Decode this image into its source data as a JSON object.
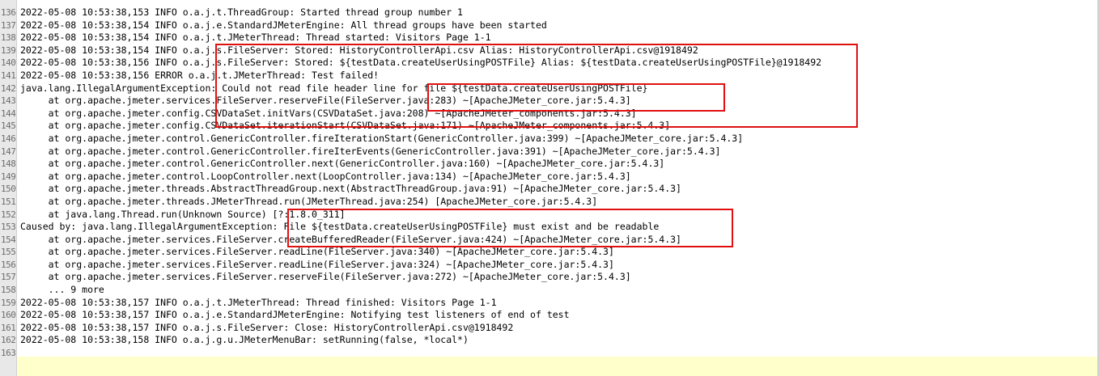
{
  "editor": {
    "lines": [
      {
        "num": "136",
        "text": "2022-05-08 10:53:38,153 INFO o.a.j.t.ThreadGroup: Started thread group number 1"
      },
      {
        "num": "137",
        "text": "2022-05-08 10:53:38,154 INFO o.a.j.e.StandardJMeterEngine: All thread groups have been started"
      },
      {
        "num": "138",
        "text": "2022-05-08 10:53:38,154 INFO o.a.j.t.JMeterThread: Thread started: Visitors Page 1-1"
      },
      {
        "num": "139",
        "text": "2022-05-08 10:53:38,154 INFO o.a.j.s.FileServer: Stored: HistoryControllerApi.csv Alias: HistoryControllerApi.csv@1918492"
      },
      {
        "num": "140",
        "text": "2022-05-08 10:53:38,156 INFO o.a.j.s.FileServer: Stored: ${testData.createUserUsingPOSTFile} Alias: ${testData.createUserUsingPOSTFile}@1918492"
      },
      {
        "num": "141",
        "text": "2022-05-08 10:53:38,156 ERROR o.a.j.t.JMeterThread: Test failed!"
      },
      {
        "num": "142",
        "text": "java.lang.IllegalArgumentException: Could not read file header line for file ${testData.createUserUsingPOSTFile}"
      },
      {
        "num": "143",
        "text": "     at org.apache.jmeter.services.FileServer.reserveFile(FileServer.java:283) ~[ApacheJMeter_core.jar:5.4.3]"
      },
      {
        "num": "144",
        "text": "     at org.apache.jmeter.config.CSVDataSet.initVars(CSVDataSet.java:208) ~[ApacheJMeter_components.jar:5.4.3]"
      },
      {
        "num": "145",
        "text": "     at org.apache.jmeter.config.CSVDataSet.iterationStart(CSVDataSet.java:171) ~[ApacheJMeter_components.jar:5.4.3]"
      },
      {
        "num": "146",
        "text": "     at org.apache.jmeter.control.GenericController.fireIterationStart(GenericController.java:399) ~[ApacheJMeter_core.jar:5.4.3]"
      },
      {
        "num": "147",
        "text": "     at org.apache.jmeter.control.GenericController.fireIterEvents(GenericController.java:391) ~[ApacheJMeter_core.jar:5.4.3]"
      },
      {
        "num": "148",
        "text": "     at org.apache.jmeter.control.GenericController.next(GenericController.java:160) ~[ApacheJMeter_core.jar:5.4.3]"
      },
      {
        "num": "149",
        "text": "     at org.apache.jmeter.control.LoopController.next(LoopController.java:134) ~[ApacheJMeter_core.jar:5.4.3]"
      },
      {
        "num": "150",
        "text": "     at org.apache.jmeter.threads.AbstractThreadGroup.next(AbstractThreadGroup.java:91) ~[ApacheJMeter_core.jar:5.4.3]"
      },
      {
        "num": "151",
        "text": "     at org.apache.jmeter.threads.JMeterThread.run(JMeterThread.java:254) [ApacheJMeter_core.jar:5.4.3]"
      },
      {
        "num": "152",
        "text": "     at java.lang.Thread.run(Unknown Source) [?:1.8.0_311]"
      },
      {
        "num": "153",
        "text": "Caused by: java.lang.IllegalArgumentException: File ${testData.createUserUsingPOSTFile} must exist and be readable"
      },
      {
        "num": "154",
        "text": "     at org.apache.jmeter.services.FileServer.createBufferedReader(FileServer.java:424) ~[ApacheJMeter_core.jar:5.4.3]"
      },
      {
        "num": "155",
        "text": "     at org.apache.jmeter.services.FileServer.readLine(FileServer.java:340) ~[ApacheJMeter_core.jar:5.4.3]"
      },
      {
        "num": "156",
        "text": "     at org.apache.jmeter.services.FileServer.readLine(FileServer.java:324) ~[ApacheJMeter_core.jar:5.4.3]"
      },
      {
        "num": "157",
        "text": "     at org.apache.jmeter.services.FileServer.reserveFile(FileServer.java:272) ~[ApacheJMeter_core.jar:5.4.3]"
      },
      {
        "num": "158",
        "text": "     ... 9 more"
      },
      {
        "num": "159",
        "text": "2022-05-08 10:53:38,157 INFO o.a.j.t.JMeterThread: Thread finished: Visitors Page 1-1"
      },
      {
        "num": "160",
        "text": "2022-05-08 10:53:38,157 INFO o.a.j.e.StandardJMeterEngine: Notifying test listeners of end of test"
      },
      {
        "num": "161",
        "text": "2022-05-08 10:53:38,157 INFO o.a.j.s.FileServer: Close: HistoryControllerApi.csv@1918492"
      },
      {
        "num": "162",
        "text": "2022-05-08 10:53:38,158 INFO o.a.j.g.u.JMeterMenuBar: setRunning(false, *local*)"
      },
      {
        "num": "163",
        "text": ""
      }
    ],
    "colors": {
      "background": "#ffffff",
      "gutter": "#e8e8e8",
      "line_number": "#6d6d6d",
      "current_line": "#ffffcc",
      "annotation_box": "#e01010"
    }
  }
}
